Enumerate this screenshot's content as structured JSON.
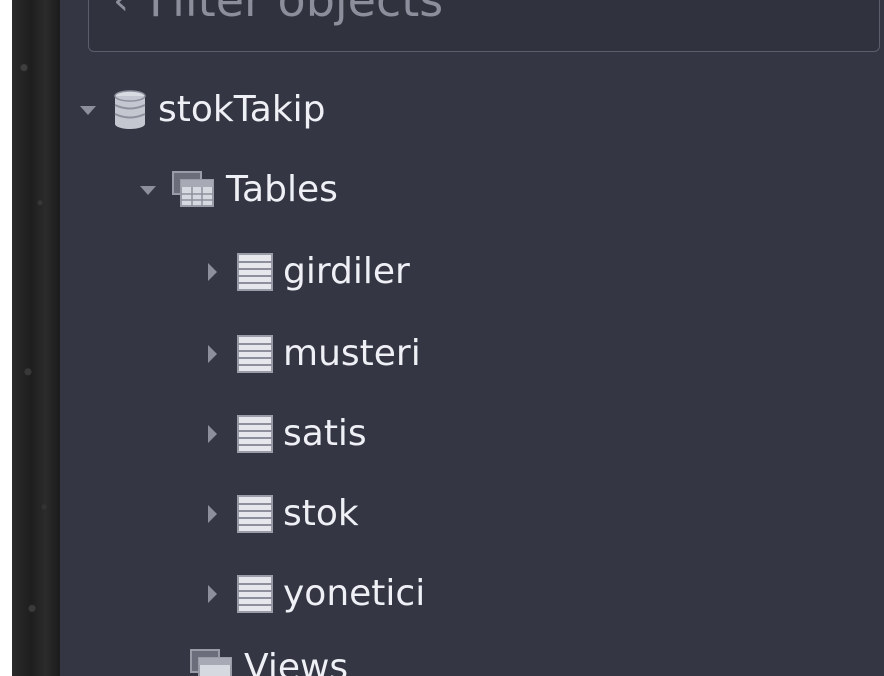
{
  "filter": {
    "placeholder": "Filter objects"
  },
  "tree": {
    "database": {
      "name": "stokTakip",
      "expanded": true,
      "icon": "database-icon"
    },
    "tables_folder": {
      "label": "Tables",
      "expanded": true,
      "icon": "tables-folder-icon"
    },
    "tables": [
      {
        "name": "girdiler",
        "icon": "table-icon"
      },
      {
        "name": "musteri",
        "icon": "table-icon"
      },
      {
        "name": "satis",
        "icon": "table-icon"
      },
      {
        "name": "stok",
        "icon": "table-icon"
      },
      {
        "name": "yonetici",
        "icon": "table-icon"
      }
    ],
    "views_folder": {
      "label": "Views",
      "icon": "views-folder-icon"
    }
  },
  "colors": {
    "panel_bg": "#343643",
    "text": "#eef0f6",
    "arrow": "#8d909c"
  }
}
